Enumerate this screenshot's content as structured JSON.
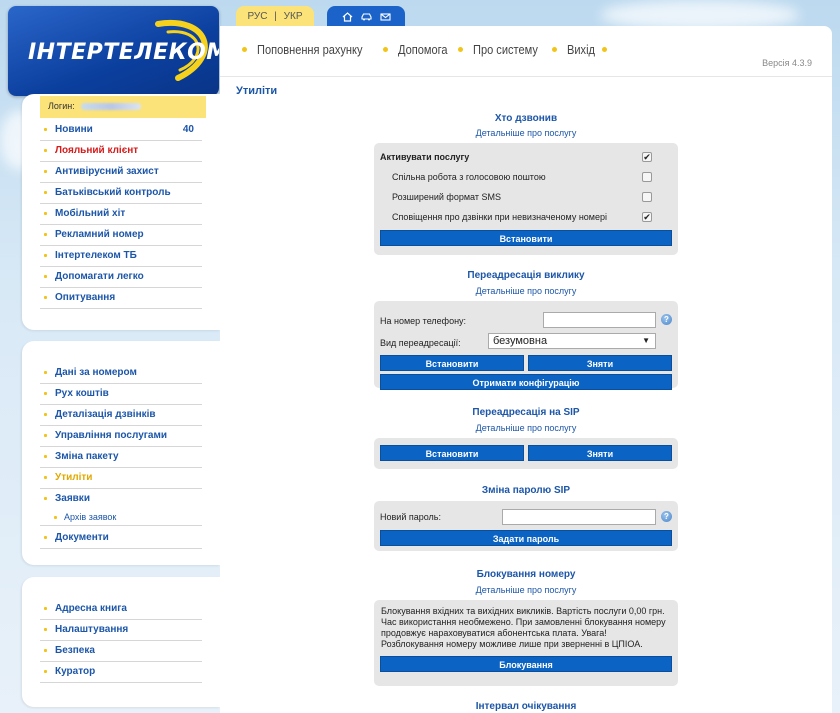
{
  "logo": {
    "text": "ІНТЕРТЕЛЕКОМ"
  },
  "lang": {
    "ru": "РУС",
    "sep": "|",
    "uk": "УКР"
  },
  "header_icons": [
    "home-icon",
    "car-icon",
    "mail-icon"
  ],
  "topnav": {
    "items": [
      "Поповнення рахунку",
      "Допомога",
      "Про систему",
      "Вихід"
    ]
  },
  "version": "Версія 4.3.9",
  "login": {
    "label": "Логин:"
  },
  "sidebar": {
    "group1": [
      {
        "label": "Новини",
        "count": "40"
      },
      {
        "label": "Лояльний клієнт"
      },
      {
        "label": "Антивірусний захист"
      },
      {
        "label": "Батьківський контроль"
      },
      {
        "label": "Мобільний хіт"
      },
      {
        "label": "Рекламний номер"
      },
      {
        "label": "Інтертелеком ТБ"
      },
      {
        "label": "Допомагати легко"
      },
      {
        "label": "Опитування"
      }
    ],
    "group2": [
      {
        "label": "Дані за номером"
      },
      {
        "label": "Рух коштів"
      },
      {
        "label": "Деталізація дзвінків"
      },
      {
        "label": "Управління послугами"
      },
      {
        "label": "Зміна пакету"
      },
      {
        "label": "Утиліти"
      },
      {
        "label": "Заявки"
      },
      {
        "label": "Архів заявок"
      },
      {
        "label": "Документи"
      }
    ],
    "group3": [
      {
        "label": "Адресна книга"
      },
      {
        "label": "Налаштування"
      },
      {
        "label": "Безпека"
      },
      {
        "label": "Куратор"
      }
    ]
  },
  "main": {
    "title": "Утиліти",
    "who_calls": {
      "title": "Хто дзвонив",
      "link": "Детальніше про послугу",
      "activate": {
        "label": "Активувати послугу",
        "checked": true
      },
      "options": [
        {
          "label": "Спільна робота з голосовою поштою",
          "checked": false
        },
        {
          "label": "Розширений формат SMS",
          "checked": false
        },
        {
          "label": "Сповіщення про дзвінки при невизначеному номері",
          "checked": true
        }
      ],
      "button": "Встановити"
    },
    "forward": {
      "title": "Переадресація виклику",
      "link": "Детальніше про послугу",
      "phone_label": "На номер телефону:",
      "phone_value": "",
      "type_label": "Вид переадресації:",
      "type_value": "безумовна",
      "set": "Встановити",
      "remove": "Зняти",
      "get_config": "Отримати конфігурацію"
    },
    "sip_forward": {
      "title": "Переадресація на SIP",
      "link": "Детальніше про послугу",
      "set": "Встановити",
      "remove": "Зняти"
    },
    "sip_password": {
      "title": "Зміна паролю SIP",
      "label": "Новий пароль:",
      "value": "",
      "button": "Задати пароль"
    },
    "block": {
      "title": "Блокування номеру",
      "link": "Детальніше про послугу",
      "text": "Блокування вхідних та вихідних викликів. Вартість послуги 0,00 грн. Час використання необмежено. При замовленні блокування номеру продовжує нараховуватися абонентська плата. Увага! Розблокування номеру можливе лише при зверненні в ЦПІОА.",
      "button": "Блокування"
    },
    "wait": {
      "title": "Інтервал очікування"
    }
  },
  "help_glyph": "?",
  "check_glyph": "✔",
  "select_arrow": "▼"
}
